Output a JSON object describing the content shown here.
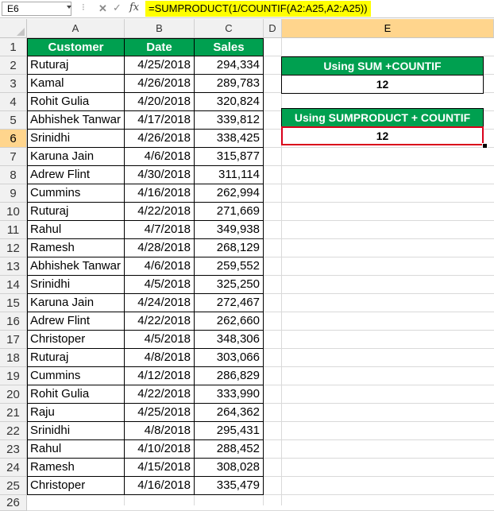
{
  "formula_bar": {
    "name_box": "E6",
    "fx_label": "fx",
    "formula": "=SUMPRODUCT(1/COUNTIF(A2:A25,A2:A25))"
  },
  "columns": [
    "A",
    "B",
    "C",
    "D",
    "E"
  ],
  "selected_column": "E",
  "rows": [
    "1",
    "2",
    "3",
    "4",
    "5",
    "6",
    "7",
    "8",
    "9",
    "10",
    "11",
    "12",
    "13",
    "14",
    "15",
    "16",
    "17",
    "18",
    "19",
    "20",
    "21",
    "22",
    "23",
    "24",
    "25",
    "26"
  ],
  "selected_row": "6",
  "table": {
    "headers": [
      "Customer",
      "Date",
      "Sales"
    ],
    "records": [
      [
        "Ruturaj",
        "4/25/2018",
        "294,334"
      ],
      [
        "Kamal",
        "4/26/2018",
        "289,783"
      ],
      [
        "Rohit Gulia",
        "4/20/2018",
        "320,824"
      ],
      [
        "Abhishek Tanwar",
        "4/17/2018",
        "339,812"
      ],
      [
        "Srinidhi",
        "4/26/2018",
        "338,425"
      ],
      [
        "Karuna Jain",
        "4/6/2018",
        "315,877"
      ],
      [
        "Adrew Flint",
        "4/30/2018",
        "311,114"
      ],
      [
        "Cummins",
        "4/16/2018",
        "262,994"
      ],
      [
        "Ruturaj",
        "4/22/2018",
        "271,669"
      ],
      [
        "Rahul",
        "4/7/2018",
        "349,938"
      ],
      [
        "Ramesh",
        "4/28/2018",
        "268,129"
      ],
      [
        "Abhishek Tanwar",
        "4/6/2018",
        "259,552"
      ],
      [
        "Srinidhi",
        "4/5/2018",
        "325,250"
      ],
      [
        "Karuna Jain",
        "4/24/2018",
        "272,467"
      ],
      [
        "Adrew Flint",
        "4/22/2018",
        "262,660"
      ],
      [
        "Christoper",
        "4/5/2018",
        "348,306"
      ],
      [
        "Ruturaj",
        "4/8/2018",
        "303,066"
      ],
      [
        "Cummins",
        "4/12/2018",
        "286,829"
      ],
      [
        "Rohit Gulia",
        "4/22/2018",
        "333,990"
      ],
      [
        "Raju",
        "4/25/2018",
        "264,362"
      ],
      [
        "Srinidhi",
        "4/8/2018",
        "295,431"
      ],
      [
        "Rahul",
        "4/10/2018",
        "288,452"
      ],
      [
        "Ramesh",
        "4/15/2018",
        "308,028"
      ],
      [
        "Christoper",
        "4/16/2018",
        "335,479"
      ]
    ]
  },
  "results": [
    {
      "label": "Using SUM +COUNTIF",
      "value": "12"
    },
    {
      "label": "Using SUMPRODUCT + COUNTIF",
      "value": "12"
    }
  ],
  "colors": {
    "header_green": "#00a050",
    "selected_header": "#ffd58d",
    "active_cell_border": "#d9001b",
    "formula_highlight": "#ffff00"
  }
}
